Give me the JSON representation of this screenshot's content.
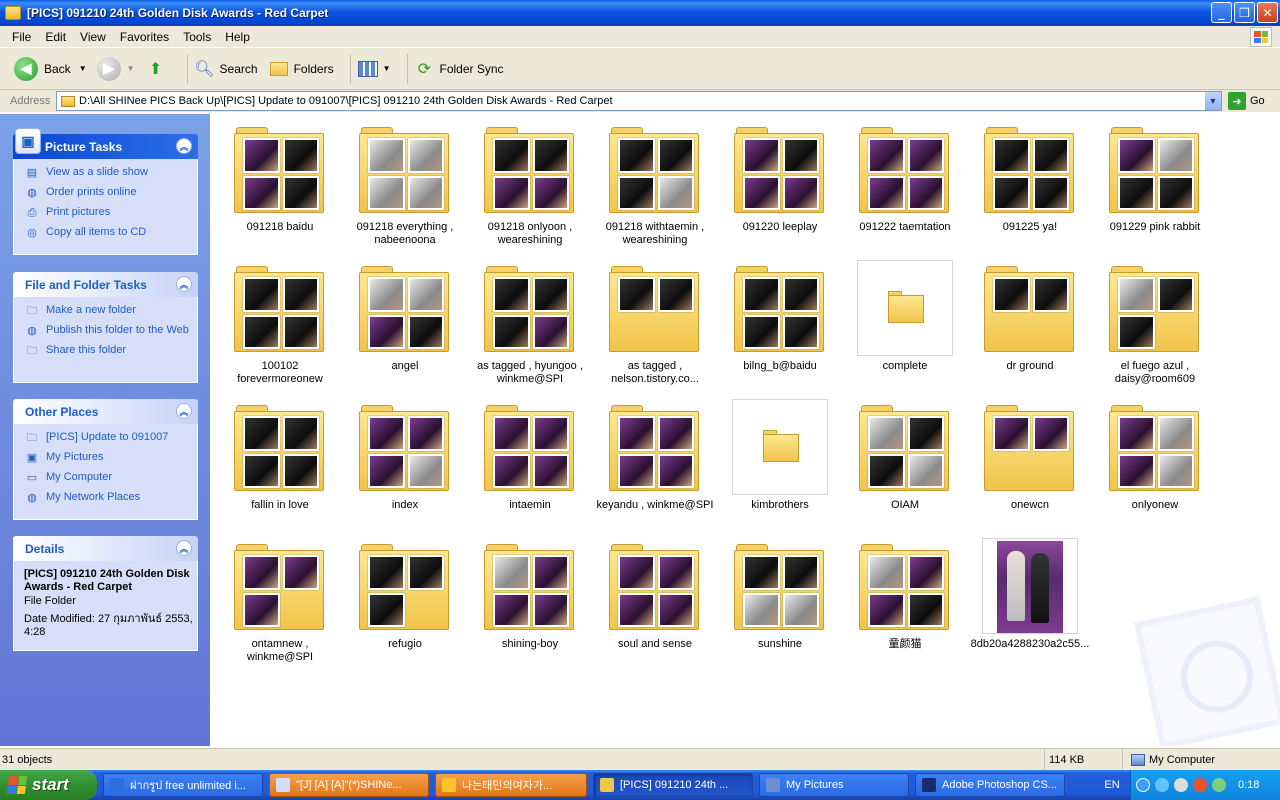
{
  "window": {
    "title": "[PICS] 091210 24th Golden Disk Awards - Red Carpet",
    "buttons": {
      "minimize": "_",
      "maximize": "❐",
      "close": "✕"
    }
  },
  "menu": [
    "File",
    "Edit",
    "View",
    "Favorites",
    "Tools",
    "Help"
  ],
  "toolbar": {
    "back": "Back",
    "search": "Search",
    "folders": "Folders",
    "folder_sync": "Folder Sync"
  },
  "address": {
    "label": "Address",
    "path": "D:\\All SHINee PICS Back Up\\[PICS] Update to 091007\\[PICS] 091210 24th Golden Disk Awards - Red Carpet",
    "go": "Go"
  },
  "left": {
    "picture_tasks": {
      "title": "Picture Tasks",
      "links": [
        "View as a slide show",
        "Order prints online",
        "Print pictures",
        "Copy all items to CD"
      ]
    },
    "file_tasks": {
      "title": "File and Folder Tasks",
      "links": [
        "Make a new folder",
        "Publish this folder to the Web",
        "Share this folder"
      ]
    },
    "other_places": {
      "title": "Other Places",
      "links": [
        "[PICS] Update to 091007",
        "My Pictures",
        "My Computer",
        "My Network Places"
      ]
    },
    "details": {
      "title": "Details",
      "name": "[PICS] 091210 24th Golden Disk Awards - Red Carpet",
      "type": "File Folder",
      "modified": "Date Modified: 27 กุมภาพันธ์ 2553, 4:28"
    }
  },
  "items": [
    {
      "label": "091218 baidu",
      "kind": "folder",
      "photos": [
        "p",
        "d",
        "p",
        "d"
      ]
    },
    {
      "label": "091218 everything , nabeenoona",
      "kind": "folder",
      "photos": [
        "g",
        "g",
        "g",
        "g"
      ]
    },
    {
      "label": "091218 onlyoon , weareshining",
      "kind": "folder",
      "photos": [
        "d",
        "d",
        "p",
        "p"
      ]
    },
    {
      "label": "091218 withtaemin , weareshining",
      "kind": "folder",
      "photos": [
        "d",
        "d",
        "d",
        "g"
      ]
    },
    {
      "label": "091220 leeplay",
      "kind": "folder",
      "photos": [
        "p",
        "d",
        "p",
        "p"
      ]
    },
    {
      "label": "091222 taemtation",
      "kind": "folder",
      "photos": [
        "p",
        "p",
        "p",
        "p"
      ]
    },
    {
      "label": "091225 ya!",
      "kind": "folder",
      "photos": [
        "d",
        "d",
        "d",
        "d"
      ]
    },
    {
      "label": "091229 pink rabbit",
      "kind": "folder",
      "photos": [
        "p",
        "g",
        "d",
        "d"
      ]
    },
    {
      "label": "100102 forevermoreonew",
      "kind": "folder",
      "photos": [
        "d",
        "d",
        "d",
        "d"
      ]
    },
    {
      "label": "angel",
      "kind": "folder",
      "photos": [
        "g",
        "g",
        "p",
        "d"
      ]
    },
    {
      "label": "as tagged , hyungoo , winkme@SPI",
      "kind": "folder",
      "photos": [
        "d",
        "d",
        "d",
        "p"
      ]
    },
    {
      "label": "as tagged , nelson.tistory.co...",
      "kind": "folder",
      "photos": [
        "d",
        "d",
        "x",
        "x"
      ]
    },
    {
      "label": "bilng_b@baidu",
      "kind": "folder",
      "photos": [
        "d",
        "d",
        "d",
        "d"
      ]
    },
    {
      "label": "complete",
      "kind": "empty"
    },
    {
      "label": "dr ground",
      "kind": "folder",
      "photos": [
        "d",
        "d",
        "x",
        "x"
      ]
    },
    {
      "label": "el fuego azul , daisy@room609",
      "kind": "folder",
      "photos": [
        "g",
        "d",
        "d",
        "x"
      ]
    },
    {
      "label": "fallin in love",
      "kind": "folder",
      "photos": [
        "d",
        "d",
        "d",
        "d"
      ]
    },
    {
      "label": "index",
      "kind": "folder",
      "photos": [
        "p",
        "p",
        "p",
        "g"
      ]
    },
    {
      "label": "intaemin",
      "kind": "folder",
      "photos": [
        "p",
        "p",
        "p",
        "p"
      ]
    },
    {
      "label": "keyandu , winkme@SPI",
      "kind": "folder",
      "photos": [
        "p",
        "p",
        "p",
        "p"
      ]
    },
    {
      "label": "kimbrothers",
      "kind": "empty"
    },
    {
      "label": "OIAM",
      "kind": "folder",
      "photos": [
        "g",
        "d",
        "d",
        "g"
      ]
    },
    {
      "label": "onewcn",
      "kind": "folder",
      "photos": [
        "p",
        "p",
        "x",
        "x"
      ]
    },
    {
      "label": "onlyonew",
      "kind": "folder",
      "photos": [
        "p",
        "g",
        "p",
        "g"
      ]
    },
    {
      "label": "ontamnew , winkme@SPI",
      "kind": "folder",
      "photos": [
        "p",
        "p",
        "p",
        "x"
      ]
    },
    {
      "label": "refugio",
      "kind": "folder",
      "photos": [
        "d",
        "d",
        "d",
        "x"
      ]
    },
    {
      "label": "shining-boy",
      "kind": "folder",
      "photos": [
        "g",
        "p",
        "p",
        "p"
      ]
    },
    {
      "label": "soul and sense",
      "kind": "folder",
      "photos": [
        "p",
        "p",
        "p",
        "p"
      ]
    },
    {
      "label": "sunshine",
      "kind": "folder",
      "photos": [
        "d",
        "d",
        "g",
        "g"
      ]
    },
    {
      "label": "童颜猫",
      "kind": "folder",
      "photos": [
        "g",
        "p",
        "p",
        "d"
      ]
    },
    {
      "label": "8db20a4288230a2c55...",
      "kind": "photo"
    }
  ],
  "status": {
    "objects": "31 objects",
    "size": "114 KB",
    "location": "My Computer"
  },
  "taskbar": {
    "start": "start",
    "tasks": [
      {
        "label": "ฝากรูป free unlimited i...",
        "style": "normal"
      },
      {
        "label": "\"[J] [A] [A]\"(*)SHINe...",
        "style": "orange"
      },
      {
        "label": "나는태민의여자가...",
        "style": "orange"
      },
      {
        "label": "[PICS] 091210 24th ...",
        "style": "active"
      },
      {
        "label": "My Pictures",
        "style": "normal"
      },
      {
        "label": "Adobe Photoshop CS...",
        "style": "normal"
      }
    ],
    "lang": "EN",
    "clock": "0:18"
  },
  "colors": {
    "accent": "#215dc6",
    "titlebar": "#0a5ee6",
    "taskbar": "#245edb"
  }
}
